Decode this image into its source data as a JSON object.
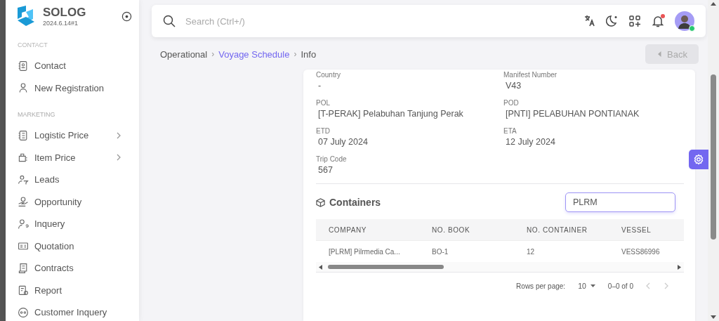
{
  "sidebar": {
    "logo_text": "SOLOG",
    "version": "2024.6.14#1",
    "sections": [
      {
        "heading": "CONTACT",
        "items": [
          {
            "label": "Contact",
            "has_submenu": false
          },
          {
            "label": "New Registration",
            "has_submenu": false
          }
        ]
      },
      {
        "heading": "MARKETING",
        "items": [
          {
            "label": "Logistic Price",
            "has_submenu": true
          },
          {
            "label": "Item Price",
            "has_submenu": true
          },
          {
            "label": "Leads",
            "has_submenu": false
          },
          {
            "label": "Opportunity",
            "has_submenu": false
          },
          {
            "label": "Inquery",
            "has_submenu": false
          },
          {
            "label": "Quotation",
            "has_submenu": false
          },
          {
            "label": "Contracts",
            "has_submenu": false
          },
          {
            "label": "Report",
            "has_submenu": false
          },
          {
            "label": "Customer Inquery",
            "has_submenu": false
          }
        ]
      }
    ]
  },
  "topbar": {
    "search": {
      "placeholder": "Search (Ctrl+/)"
    },
    "notifications_unread": true,
    "user_online": true
  },
  "breadcrumb": {
    "separator": "›",
    "items": [
      {
        "label": "Operational",
        "link": false
      },
      {
        "label": "Voyage Schedule",
        "link": true
      },
      {
        "label": "Info",
        "link": false
      }
    ]
  },
  "back_button": {
    "label": "Back",
    "disabled": true
  },
  "details": [
    {
      "label": "Country",
      "value": "-"
    },
    {
      "label": "Manifest Number",
      "value": "V43"
    },
    {
      "label": "POL",
      "value": "[T-PERAK] Pelabuhan Tanjung Perak"
    },
    {
      "label": "POD",
      "value": "[PNTI] PELABUHAN PONTIANAK"
    },
    {
      "label": "ETD",
      "value": "07 July 2024"
    },
    {
      "label": "ETA",
      "value": "12 July 2024"
    },
    {
      "label": "Trip Code",
      "value": "567"
    }
  ],
  "containers": {
    "title": "Containers",
    "search": {
      "value": "PLRM"
    },
    "columns": [
      "COMPANY",
      "NO. BOOK",
      "NO. CONTAINER",
      "VESSEL"
    ],
    "rows": [
      [
        "[PLRM] Pilrmedia Ca...",
        "BO-1",
        "12",
        "VESS86996"
      ]
    ],
    "pagination": {
      "rows_per_page_label": "Rows per page:",
      "rows_per_page": "10",
      "range": "0–0 of 0"
    }
  }
}
